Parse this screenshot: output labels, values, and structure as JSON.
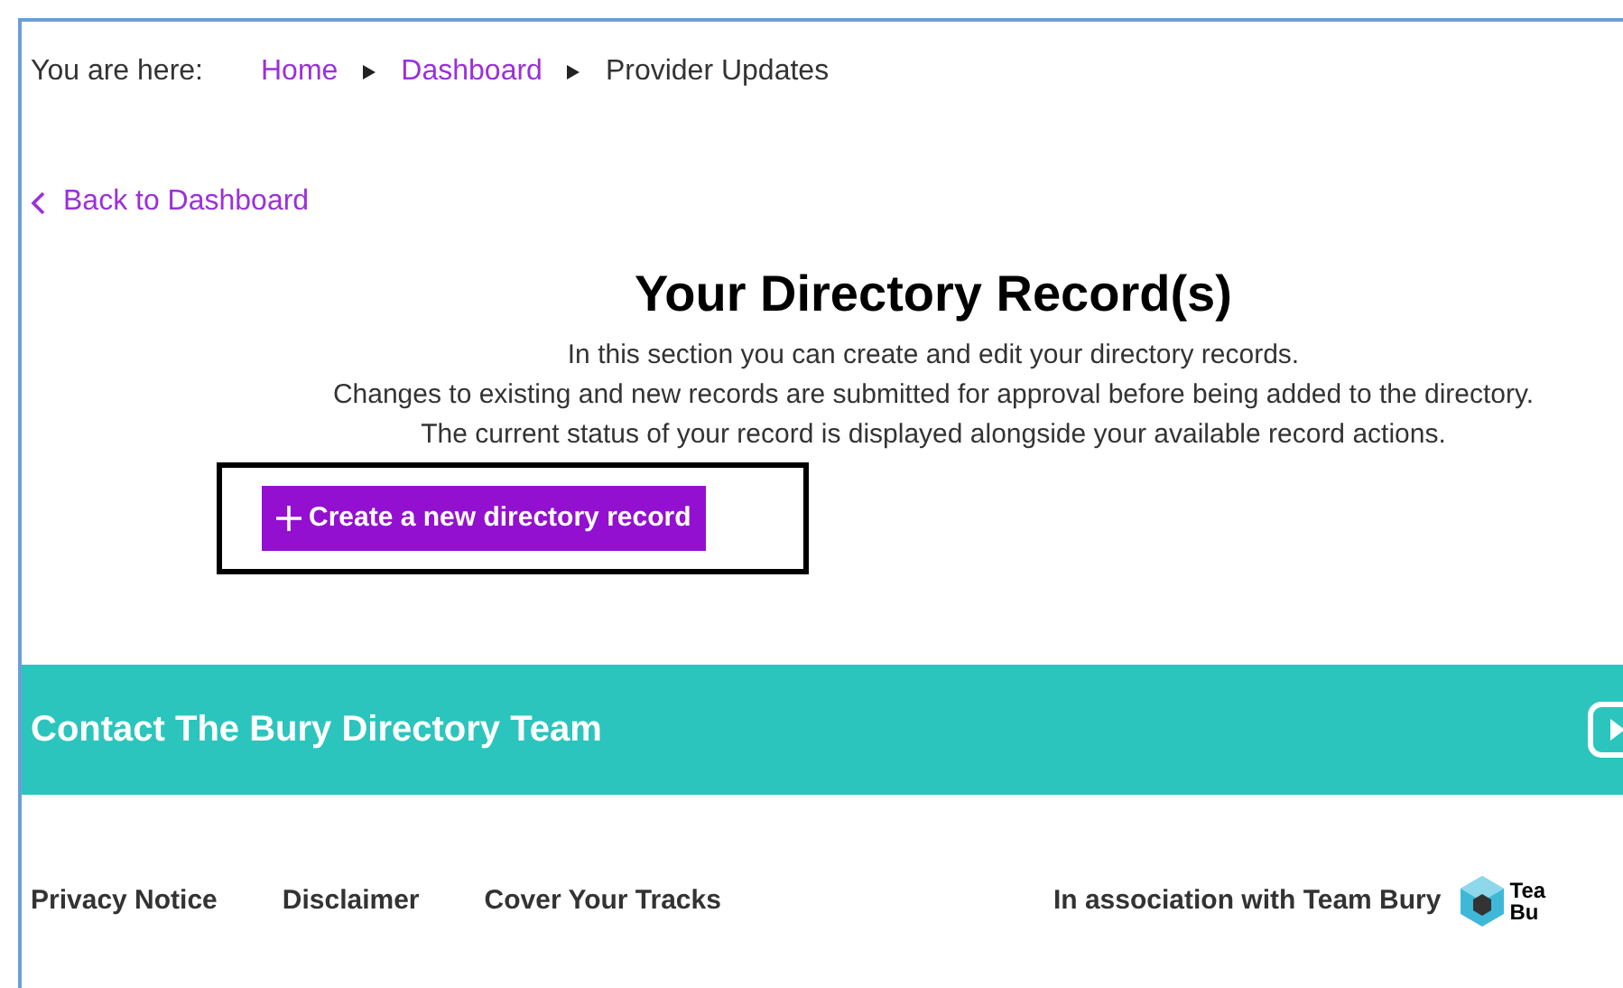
{
  "breadcrumb": {
    "label": "You are here:",
    "items": [
      {
        "text": "Home",
        "kind": "link"
      },
      {
        "text": "Dashboard",
        "kind": "link"
      },
      {
        "text": "Provider Updates",
        "kind": "current"
      }
    ]
  },
  "back_link": "Back to Dashboard",
  "heading": "Your Directory Record(s)",
  "intro": [
    "In this section you can create and edit your directory records.",
    "Changes to existing and new records are submitted for approval before being added to the directory.",
    "The current status of your record is displayed alongside your available record actions."
  ],
  "create_button": "Create a new directory record",
  "contact_band": {
    "title": "Contact The Bury Directory Team"
  },
  "footer": {
    "links": [
      "Privacy Notice",
      "Disclaimer",
      "Cover Your Tracks"
    ],
    "association": "In association with Team Bury",
    "logo_text": [
      "Tea",
      "Bu"
    ]
  }
}
